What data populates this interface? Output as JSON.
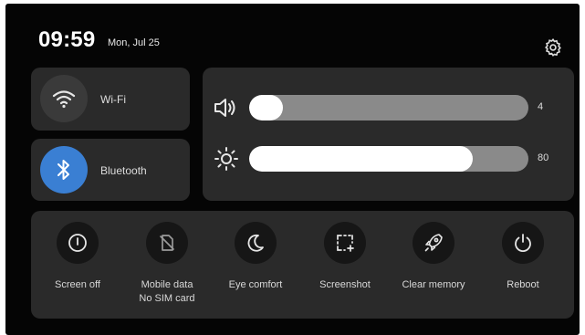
{
  "status": {
    "time": "09:59",
    "date": "Mon, Jul 25"
  },
  "icons": {
    "settings": "gear-icon"
  },
  "toggles": [
    {
      "label": "Wi-Fi",
      "icon": "wifi-icon",
      "active": false
    },
    {
      "label": "Bluetooth",
      "icon": "bluetooth-icon",
      "active": true,
      "accent": "#3a7fd3"
    }
  ],
  "sliders": {
    "volume": {
      "icon": "speaker-icon",
      "value": "4",
      "level": 0.12
    },
    "brightness": {
      "icon": "sun-icon",
      "value": "80",
      "level": 0.8
    }
  },
  "actions": [
    {
      "label": "Screen off",
      "sublabel": "",
      "icon": "power-circle-icon"
    },
    {
      "label": "Mobile data",
      "sublabel": "No SIM card",
      "icon": "no-sim-icon"
    },
    {
      "label": "Eye comfort",
      "sublabel": "",
      "icon": "moon-icon"
    },
    {
      "label": "Screenshot",
      "sublabel": "",
      "icon": "screenshot-icon"
    },
    {
      "label": "Clear memory",
      "sublabel": "",
      "icon": "rocket-icon"
    },
    {
      "label": "Reboot",
      "sublabel": "",
      "icon": "power-icon"
    }
  ]
}
